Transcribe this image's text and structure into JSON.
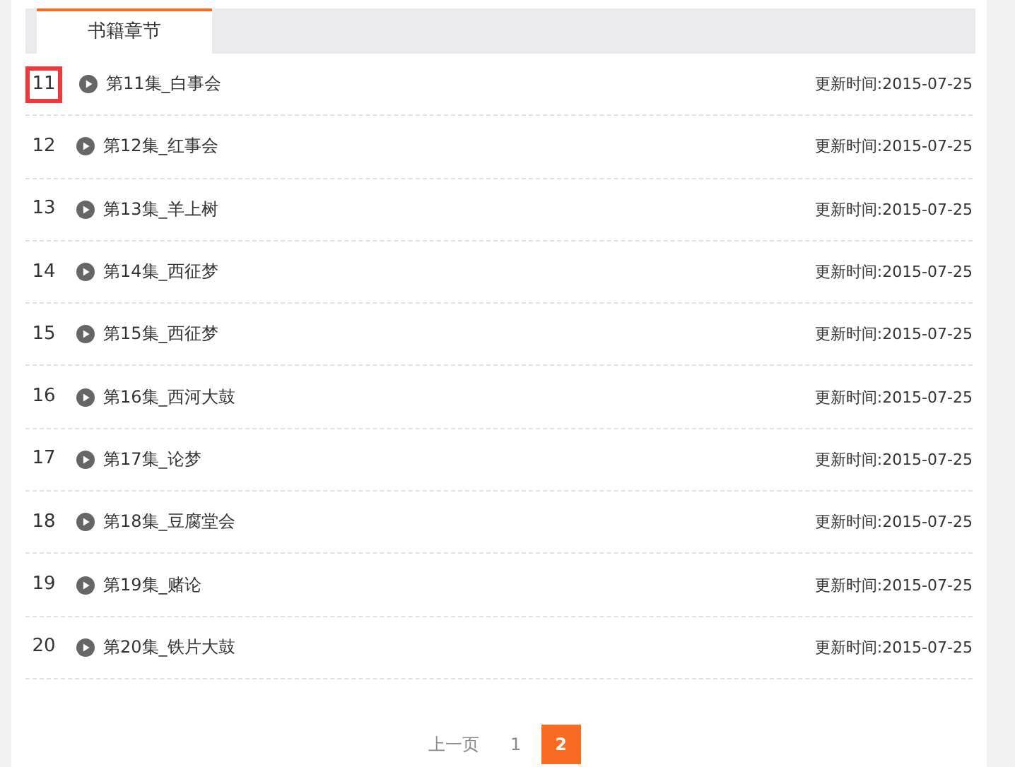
{
  "tabs": [
    {
      "label": "书籍章节",
      "selected": true
    }
  ],
  "chapters": [
    {
      "number": "11",
      "title": "第11集_白事会",
      "updated": "更新时间:2015-07-25",
      "highlighted": true
    },
    {
      "number": "12",
      "title": "第12集_红事会",
      "updated": "更新时间:2015-07-25",
      "highlighted": false
    },
    {
      "number": "13",
      "title": "第13集_羊上树",
      "updated": "更新时间:2015-07-25",
      "highlighted": false
    },
    {
      "number": "14",
      "title": "第14集_西征梦",
      "updated": "更新时间:2015-07-25",
      "highlighted": false
    },
    {
      "number": "15",
      "title": "第15集_西征梦",
      "updated": "更新时间:2015-07-25",
      "highlighted": false
    },
    {
      "number": "16",
      "title": "第16集_西河大鼓",
      "updated": "更新时间:2015-07-25",
      "highlighted": false
    },
    {
      "number": "17",
      "title": "第17集_论梦",
      "updated": "更新时间:2015-07-25",
      "highlighted": false
    },
    {
      "number": "18",
      "title": "第18集_豆腐堂会",
      "updated": "更新时间:2015-07-25",
      "highlighted": false
    },
    {
      "number": "19",
      "title": "第19集_赌论",
      "updated": "更新时间:2015-07-25",
      "highlighted": false
    },
    {
      "number": "20",
      "title": "第20集_铁片大鼓",
      "updated": "更新时间:2015-07-25",
      "highlighted": false
    }
  ],
  "pagination": [
    {
      "label": "上一页",
      "selected": false
    },
    {
      "label": "1",
      "selected": false
    },
    {
      "label": "2",
      "selected": true
    }
  ]
}
